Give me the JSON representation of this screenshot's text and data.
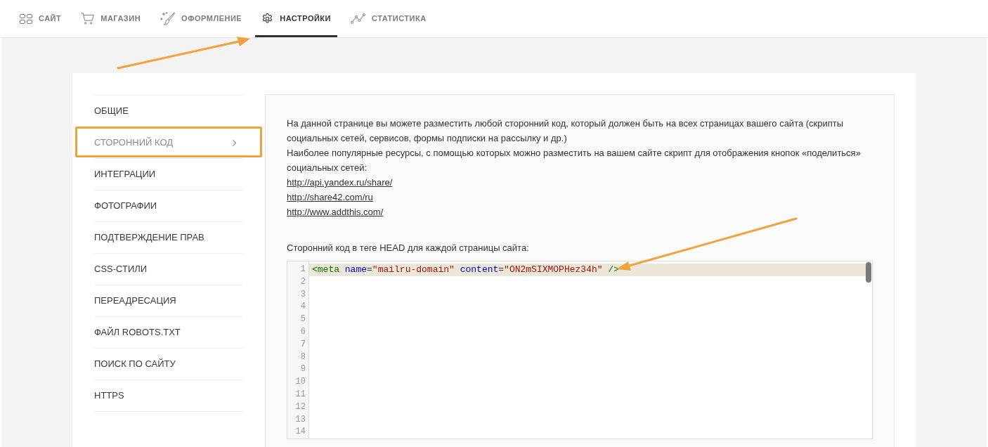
{
  "top_nav": {
    "tabs": [
      {
        "label": "САЙТ",
        "selected": false
      },
      {
        "label": "МАГАЗИН",
        "selected": false
      },
      {
        "label": "ОФОРМЛЕНИЕ",
        "selected": false
      },
      {
        "label": "НАСТРОЙКИ",
        "selected": true
      },
      {
        "label": "СТАТИСТИКА",
        "selected": false
      }
    ]
  },
  "settings_menu": {
    "items": [
      {
        "label": "ОБЩИЕ",
        "selected": false
      },
      {
        "label": "СТОРОННИЙ КОД",
        "selected": true
      },
      {
        "label": "ИНТЕГРАЦИИ",
        "selected": false
      },
      {
        "label": "ФОТОГРАФИИ",
        "selected": false
      },
      {
        "label": "ПОДТВЕРЖДЕНИЕ ПРАВ",
        "selected": false
      },
      {
        "label": "CSS-СТИЛИ",
        "selected": false
      },
      {
        "label": "ПЕРЕАДРЕСАЦИЯ",
        "selected": false
      },
      {
        "label": "ФАЙЛ ROBOTS.TXT",
        "selected": false
      },
      {
        "label": "ПОИСК ПО САЙТУ",
        "selected": false
      },
      {
        "label": "HTTPS",
        "selected": false
      }
    ]
  },
  "third_party_code": {
    "paragraphs": [
      "На данной странице вы можете разместить любой сторонний код, который должен быть на всех страницах вашего сайта (скрипты социальных сетей, сервисов, формы подписки на рассылку и др.)",
      "Наиболее популярные ресурсы, с помощью которых можно разместить на вашем сайте скрипт для отображения кнопок «поделиться» социальных сетей:"
    ],
    "links": [
      "http://api.yandex.ru/share/",
      "http://share42.com/ru",
      "http://www.addthis.com/"
    ],
    "field_label": "Сторонний код в теге HEAD для каждой страницы сайта:",
    "editor": {
      "lines": [
        {
          "number": "1",
          "active": true,
          "tokens": [
            {
              "kind": "tag",
              "text": "<meta"
            },
            {
              "kind": "attribute",
              "text": " name"
            },
            {
              "kind": "operator",
              "text": "="
            },
            {
              "kind": "string",
              "text": "\"mailru-domain\""
            },
            {
              "kind": "attribute",
              "text": " content"
            },
            {
              "kind": "operator",
              "text": "="
            },
            {
              "kind": "string",
              "text": "\"ON2mSIXMOPHez34h\""
            },
            {
              "kind": "tag",
              "text": " />"
            }
          ]
        },
        {
          "number": "2",
          "active": false
        },
        {
          "number": "3",
          "active": false
        },
        {
          "number": "4",
          "active": false
        },
        {
          "number": "5",
          "active": false
        },
        {
          "number": "6",
          "active": false
        },
        {
          "number": "7",
          "active": false
        },
        {
          "number": "8",
          "active": false
        },
        {
          "number": "9",
          "active": false
        },
        {
          "number": "10",
          "active": false
        },
        {
          "number": "11",
          "active": false
        },
        {
          "number": "12",
          "active": false
        },
        {
          "number": "13",
          "active": false
        },
        {
          "number": "14",
          "active": false
        }
      ]
    }
  }
}
